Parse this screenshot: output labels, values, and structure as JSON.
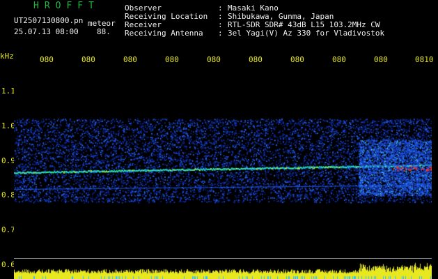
{
  "header": {
    "logo": "HROFFT",
    "filename": "UT2507130800.pn",
    "tag": "meteor",
    "datetime": "25.07.13 08:00",
    "count": "88."
  },
  "info": [
    {
      "label": "Observer",
      "value": "Masaki Kano"
    },
    {
      "label": "Receiving Location",
      "value": "Shibukawa, Gunma, Japan"
    },
    {
      "label": "Receiver",
      "value": "RTL-SDR SDR# 43dB L15 103.2MHz CW"
    },
    {
      "label": "Receiving Antenna",
      "value": "3el Yagi(V) Az 330 for Vladivostok"
    }
  ],
  "separator": ":",
  "y_axis": {
    "unit": "kHz",
    "ticks": [
      "1.1",
      "1.0",
      "0.9",
      "0.8",
      "0.7",
      "0.6"
    ]
  },
  "x_axis": {
    "labels": [
      "080",
      "080",
      "080",
      "080",
      "080",
      "080",
      "080",
      "080",
      "080",
      "0810"
    ]
  },
  "colors": {
    "logo": "#1fb83a",
    "text": "#f0f0f0",
    "axis": "#e8e81e",
    "noise": "#1030c0",
    "trace": "#20d0e0",
    "hot": "#ff3030"
  }
}
